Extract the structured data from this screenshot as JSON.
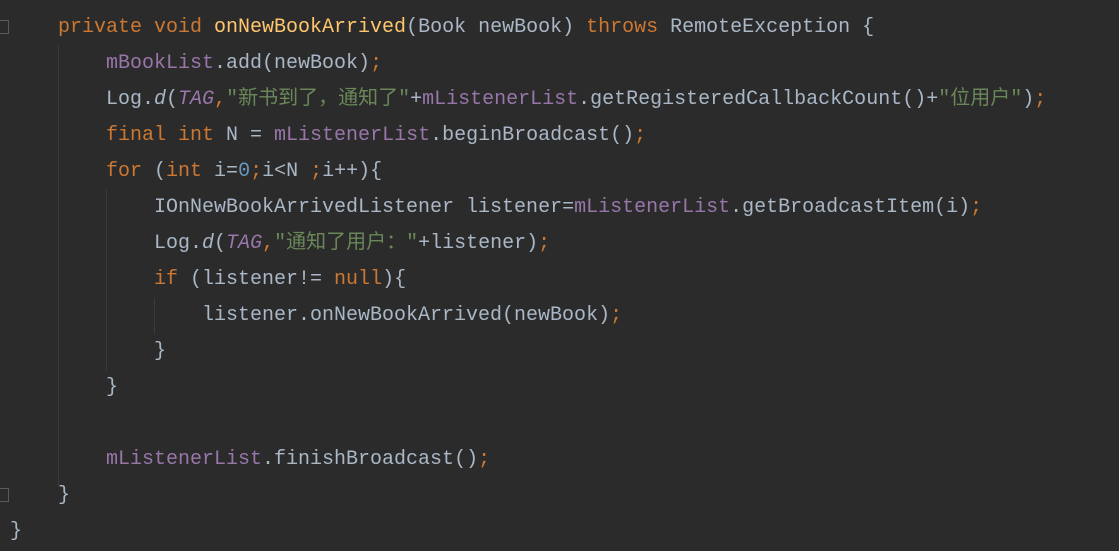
{
  "editor": {
    "lines": [
      {
        "indent": 1,
        "tokens": [
          [
            "private ",
            "kw"
          ],
          [
            "void ",
            "kw"
          ],
          [
            "onNewBookArrived",
            "fn"
          ],
          [
            "(Book newBook) ",
            ""
          ],
          [
            "throws ",
            "kw"
          ],
          [
            "RemoteException {",
            ""
          ]
        ]
      },
      {
        "indent": 2,
        "tokens": [
          [
            "mBookList",
            "fld"
          ],
          [
            ".add(newBook)",
            ""
          ],
          [
            ";",
            "kw"
          ]
        ]
      },
      {
        "indent": 2,
        "tokens": [
          [
            "Log.",
            ""
          ],
          [
            "d",
            "it"
          ],
          [
            "(",
            ""
          ],
          [
            "TAG",
            "sfld"
          ],
          [
            ",",
            "kw"
          ],
          [
            "\"新书到了，通知了\"",
            "str"
          ],
          [
            "+",
            ""
          ],
          [
            "mListenerList",
            "fld"
          ],
          [
            ".getRegisteredCallbackCount()+",
            ""
          ],
          [
            "\"位用户\"",
            "str"
          ],
          [
            ")",
            ""
          ],
          [
            ";",
            "kw"
          ]
        ]
      },
      {
        "indent": 2,
        "tokens": [
          [
            "final ",
            "kw"
          ],
          [
            "int ",
            "kw"
          ],
          [
            "N = ",
            ""
          ],
          [
            "mListenerList",
            "fld"
          ],
          [
            ".beginBroadcast()",
            ""
          ],
          [
            ";",
            "kw"
          ]
        ]
      },
      {
        "indent": 2,
        "tokens": [
          [
            "for ",
            "kw"
          ],
          [
            "(",
            ""
          ],
          [
            "int ",
            "kw"
          ],
          [
            "i=",
            ""
          ],
          [
            "0",
            "num"
          ],
          [
            ";",
            "kw"
          ],
          [
            "i<N ",
            ""
          ],
          [
            ";",
            "kw"
          ],
          [
            "i++){",
            ""
          ]
        ]
      },
      {
        "indent": 3,
        "tokens": [
          [
            "IOnNewBookArrivedListener listener=",
            ""
          ],
          [
            "mListenerList",
            "fld"
          ],
          [
            ".getBroadcastItem(i)",
            ""
          ],
          [
            ";",
            "kw"
          ]
        ]
      },
      {
        "indent": 3,
        "tokens": [
          [
            "Log.",
            ""
          ],
          [
            "d",
            "it"
          ],
          [
            "(",
            ""
          ],
          [
            "TAG",
            "sfld"
          ],
          [
            ",",
            "kw"
          ],
          [
            "\"通知了用户：\"",
            "str"
          ],
          [
            "+listener)",
            ""
          ],
          [
            ";",
            "kw"
          ]
        ]
      },
      {
        "indent": 3,
        "tokens": [
          [
            "if ",
            "kw"
          ],
          [
            "(listener!= ",
            ""
          ],
          [
            "null",
            "kw"
          ],
          [
            "){",
            ""
          ]
        ]
      },
      {
        "indent": 4,
        "tokens": [
          [
            "listener.onNewBookArrived(newBook)",
            ""
          ],
          [
            ";",
            "kw"
          ]
        ]
      },
      {
        "indent": 3,
        "tokens": [
          [
            "}",
            ""
          ]
        ]
      },
      {
        "indent": 2,
        "tokens": [
          [
            "}",
            ""
          ]
        ]
      },
      {
        "indent": 2,
        "tokens": []
      },
      {
        "indent": 2,
        "tokens": [
          [
            "mListenerList",
            "fld"
          ],
          [
            ".finishBroadcast()",
            ""
          ],
          [
            ";",
            "kw"
          ]
        ]
      },
      {
        "indent": 1,
        "tokens": [
          [
            "}",
            ""
          ]
        ]
      },
      {
        "indent": 0,
        "tokens": [
          [
            "}",
            ""
          ]
        ]
      }
    ]
  }
}
